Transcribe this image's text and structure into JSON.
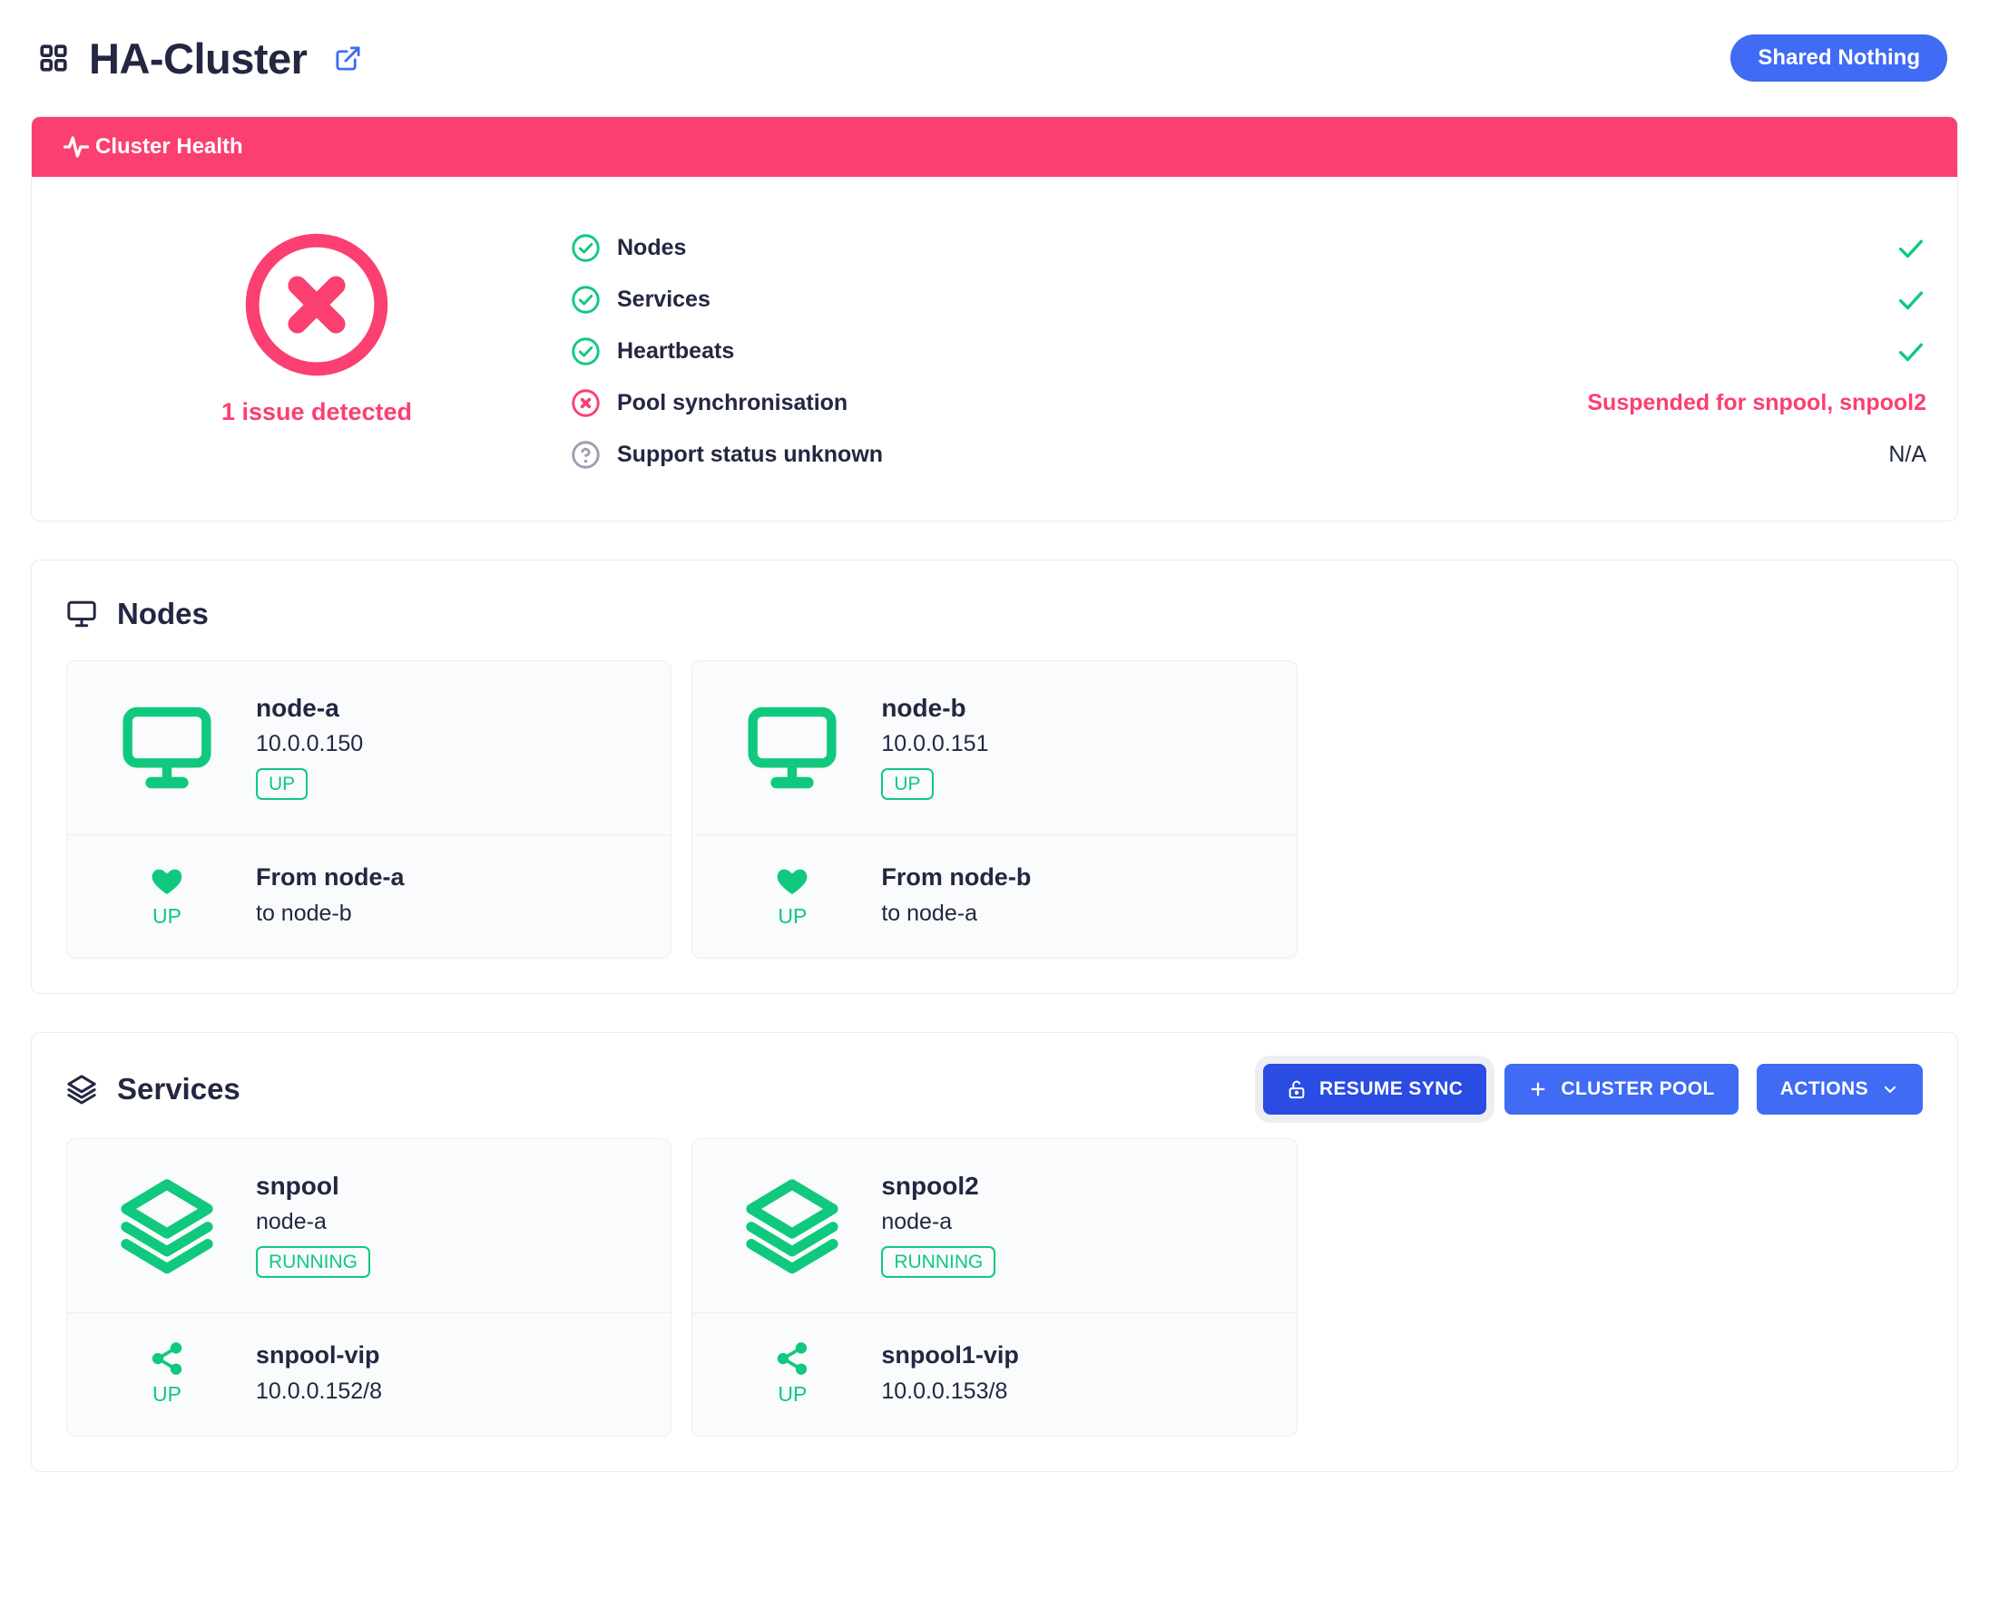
{
  "header": {
    "title": "HA-Cluster",
    "grid_icon": "grid-icon",
    "external_link_icon": "external-link-icon",
    "mode_badge": "Shared Nothing"
  },
  "cluster_health": {
    "header_label": "Cluster Health",
    "header_icon": "activity-pulse-icon",
    "header_color": "#fb3f70",
    "summary_icon": "circle-x-icon",
    "summary_text": "1 issue detected",
    "summary_color": "#fb3f70",
    "checks": [
      {
        "icon": "check-circle-icon",
        "icon_state": "ok",
        "label": "Nodes",
        "status_type": "tick",
        "status_text": ""
      },
      {
        "icon": "check-circle-icon",
        "icon_state": "ok",
        "label": "Services",
        "status_type": "tick",
        "status_text": ""
      },
      {
        "icon": "check-circle-icon",
        "icon_state": "ok",
        "label": "Heartbeats",
        "status_type": "tick",
        "status_text": ""
      },
      {
        "icon": "x-circle-icon",
        "icon_state": "error",
        "label": "Pool synchronisation",
        "status_type": "bad",
        "status_text": "Suspended for snpool, snpool2"
      },
      {
        "icon": "question-circle-icon",
        "icon_state": "unknown",
        "label": "Support status unknown",
        "status_type": "na",
        "status_text": "N/A"
      }
    ]
  },
  "nodes_section": {
    "title": "Nodes",
    "icon": "monitor-icon",
    "cards": [
      {
        "glyph": "monitor-icon",
        "name": "node-a",
        "address": "10.0.0.150",
        "state": "UP",
        "foot_glyph": "heart-icon",
        "foot_state": "UP",
        "foot_title": "From node-a",
        "foot_sub": "to node-b"
      },
      {
        "glyph": "monitor-icon",
        "name": "node-b",
        "address": "10.0.0.151",
        "state": "UP",
        "foot_glyph": "heart-icon",
        "foot_state": "UP",
        "foot_title": "From node-b",
        "foot_sub": "to node-a"
      }
    ]
  },
  "services_section": {
    "title": "Services",
    "icon": "layers-icon",
    "buttons": [
      {
        "label": "RESUME SYNC",
        "icon": "unlock-icon",
        "style": "focused"
      },
      {
        "label": "CLUSTER POOL",
        "icon": "plus-icon",
        "style": "primary"
      },
      {
        "label": "ACTIONS",
        "icon": "chevron-down-icon",
        "style": "primary"
      }
    ],
    "cards": [
      {
        "glyph": "layers-icon",
        "name": "snpool",
        "node": "node-a",
        "state": "RUNNING",
        "foot_glyph": "share-icon",
        "foot_state": "UP",
        "foot_title": "snpool-vip",
        "foot_sub": "10.0.0.152/8"
      },
      {
        "glyph": "layers-icon",
        "name": "snpool2",
        "node": "node-a",
        "state": "RUNNING",
        "foot_glyph": "share-icon",
        "foot_state": "UP",
        "foot_title": "snpool1-vip",
        "foot_sub": "10.0.0.153/8"
      }
    ]
  },
  "colors": {
    "accent_blue": "#3f6bf5",
    "accent_blue_dark": "#2a4ce2",
    "danger_pink": "#fb3f70",
    "success_green": "#10c97e",
    "text_dark": "#232741",
    "neutral_gray": "#9aa1ad"
  }
}
